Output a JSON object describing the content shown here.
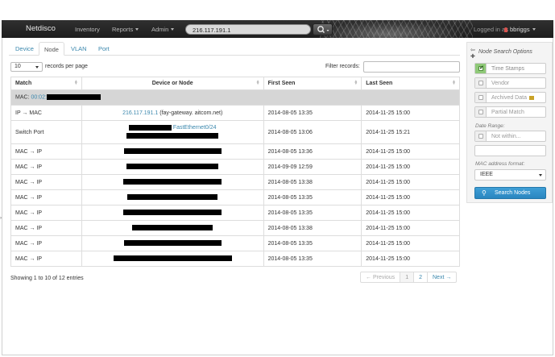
{
  "navbar": {
    "brand": "Netdisco",
    "items": [
      "Inventory",
      "Reports",
      "Admin"
    ],
    "search_value": "216.117.191.1",
    "logged_in_label": "Logged in as",
    "username": "bbriggs"
  },
  "tabs": [
    {
      "label": "Device",
      "active": false
    },
    {
      "label": "Node",
      "active": true
    },
    {
      "label": "VLAN",
      "active": false
    },
    {
      "label": "Port",
      "active": false
    }
  ],
  "table_controls": {
    "page_length": "10",
    "page_length_label": "records per page",
    "filter_label": "Filter records:"
  },
  "table": {
    "columns": [
      "Match",
      "Device or Node",
      "First Seen",
      "Last Seen"
    ],
    "group_label": "MAC: ",
    "group_mac_prefix": "00:02:",
    "rows": [
      {
        "match": "IP → MAC",
        "node_link": "216.117.191.1",
        "node_text": " (fay-gateway. aitcom.net)",
        "first": "2014-08-05 13:35",
        "last": "2014-11-25 15:00"
      },
      {
        "match": "Switch Port",
        "port_link": "FastEthernet0/24",
        "first": "2014-08-05 13:06",
        "last": "2014-11-25 15:21"
      },
      {
        "match": "MAC → IP",
        "first": "2014-08-05 13:36",
        "last": "2014-11-25 15:00"
      },
      {
        "match": "MAC → IP",
        "first": "2014-09-09 12:59",
        "last": "2014-11-25 15:00"
      },
      {
        "match": "MAC → IP",
        "first": "2014-08-05 13:38",
        "last": "2014-11-25 15:00"
      },
      {
        "match": "MAC → IP",
        "first": "2014-08-05 13:35",
        "last": "2014-11-25 15:00"
      },
      {
        "match": "MAC → IP",
        "first": "2014-08-05 13:35",
        "last": "2014-11-25 15:00"
      },
      {
        "match": "MAC → IP",
        "first": "2014-08-05 13:38",
        "last": "2014-11-25 15:00"
      },
      {
        "match": "MAC → IP",
        "first": "2014-08-05 13:35",
        "last": "2014-11-25 15:00"
      },
      {
        "match": "MAC → IP",
        "first": "2014-08-05 13:35",
        "last": "2014-11-25 15:00"
      }
    ]
  },
  "footer": {
    "info": "Showing 1 to 10 of 12 entries",
    "pager": [
      "← Previous",
      "1",
      "2",
      "Next →"
    ]
  },
  "sidebar": {
    "title": "Node Search Options",
    "options": [
      {
        "label": "Time Stamps",
        "checked": true
      },
      {
        "label": "Vendor",
        "checked": false
      },
      {
        "label": "Archived Data",
        "checked": false
      },
      {
        "label": "Partial Match",
        "checked": false
      }
    ],
    "date_range_label": "Date Range:",
    "not_within_label": "Not within...",
    "mac_format_label": "MAC address format:",
    "mac_format_value": "IEEE",
    "search_button": "Search Nodes"
  }
}
